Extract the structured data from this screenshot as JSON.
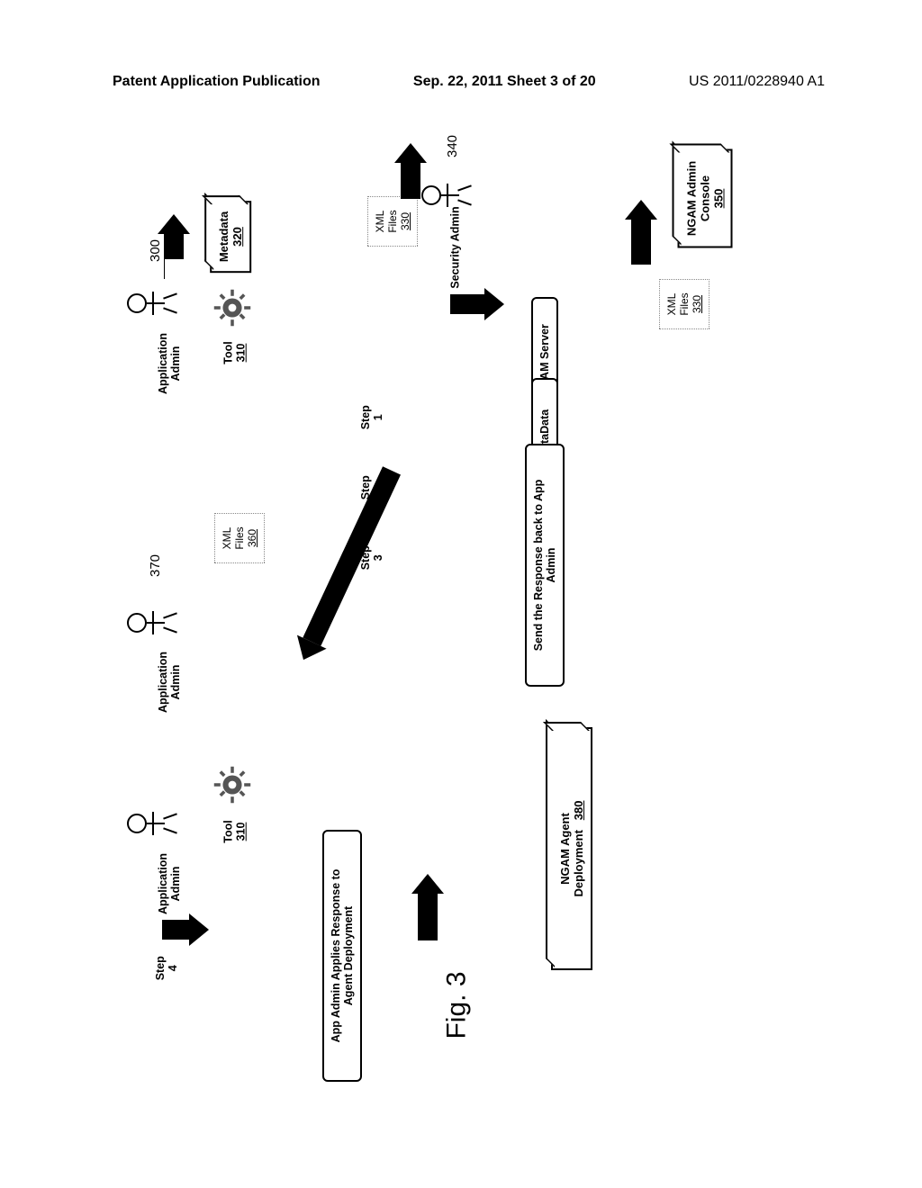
{
  "header": {
    "left": "Patent Application Publication",
    "center": "Sep. 22, 2011  Sheet 3 of 20",
    "right": "US 2011/0228940 A1"
  },
  "actors": {
    "app_admin_1": {
      "label": "Application\nAdmin",
      "ref": "300"
    },
    "security_admin": {
      "label": "Security Admin",
      "ref": "340"
    },
    "app_admin_2": {
      "label": "Application\nAdmin",
      "ref": "370"
    },
    "app_admin_3": {
      "label": "Application\nAdmin"
    }
  },
  "boxes": {
    "metadata": {
      "title": "Metadata",
      "ref": "320"
    },
    "ngam_console": {
      "title": "NGAM Admin\nConsole",
      "ref": "350"
    },
    "ngam_agent": {
      "title": "NGAM Agent\nDeployment",
      "ref": "380"
    }
  },
  "tools": {
    "tool_1": {
      "label": "Tool",
      "ref": "310"
    },
    "tool_2": {
      "label": "Tool",
      "ref": "310"
    }
  },
  "xml": {
    "x1": {
      "line1": "XML",
      "line2": "Files",
      "ref": "330"
    },
    "x2": {
      "line1": "XML",
      "line2": "Files",
      "ref": "330"
    },
    "x3": {
      "line1": "XML",
      "line2": "Files",
      "ref": "360"
    }
  },
  "steps": {
    "s1": {
      "label": "Step\n1",
      "text": "Provision Partners in NGAM Server"
    },
    "s2": {
      "label": "Step\n2",
      "text": "Generate Response MetaData"
    },
    "s3": {
      "label": "Step\n3",
      "text": "Send the Response back to App\nAdmin"
    },
    "s4": {
      "label": "Step\n4",
      "text": "App Admin Applies Response to\nAgent Deployment"
    }
  },
  "figure": "Fig. 3"
}
